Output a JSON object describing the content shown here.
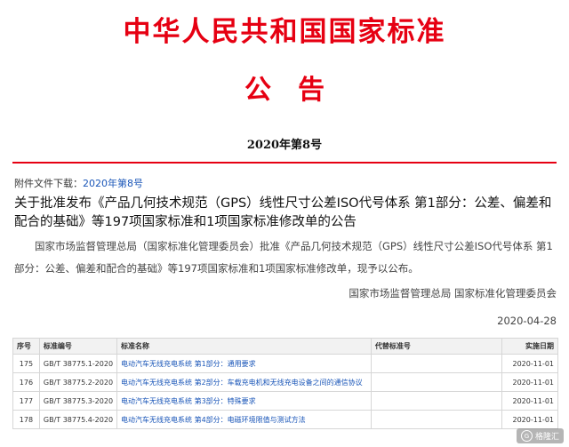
{
  "header": {
    "title": "中华人民共和国国家标准",
    "notice_label": "公告",
    "number": "2020年第8号"
  },
  "attachment": {
    "label": "附件文件下载：",
    "link_text": "2020年第8号"
  },
  "document": {
    "title": "关于批准发布《产品几何技术规范（GPS）线性尺寸公差ISO代号体系 第1部分：公差、偏差和配合的基础》等197项国家标准和1项国家标准修改单的公告",
    "body": "国家市场监督管理总局（国家标准化管理委员会）批准《产品几何技术规范（GPS）线性尺寸公差ISO代号体系 第1部分：公差、偏差和配合的基础》等197项国家标准和1项国家标准修改单，现予以公布。",
    "issuer": "国家市场监督管理总局 国家标准化管理委员会",
    "date": "2020-04-28"
  },
  "table": {
    "headers": {
      "no": "序号",
      "code": "标准编号",
      "name": "标准名称",
      "replaced": "代替标准号",
      "date": "实施日期"
    },
    "rows": [
      {
        "no": "175",
        "code": "GB/T 38775.1-2020",
        "name": "电动汽车无线充电系统 第1部分：通用要求",
        "replaced": "",
        "date": "2020-11-01"
      },
      {
        "no": "176",
        "code": "GB/T 38775.2-2020",
        "name": "电动汽车无线充电系统 第2部分：车载充电机和无线充电设备之间的通信协议",
        "replaced": "",
        "date": "2020-11-01"
      },
      {
        "no": "177",
        "code": "GB/T 38775.3-2020",
        "name": "电动汽车无线充电系统 第3部分：特殊要求",
        "replaced": "",
        "date": "2020-11-01"
      },
      {
        "no": "178",
        "code": "GB/T 38775.4-2020",
        "name": "电动汽车无线充电系统 第4部分：电磁环境限值与测试方法",
        "replaced": "",
        "date": "2020-11-01"
      }
    ]
  },
  "watermark": {
    "icon": "gelonghui-logo-icon",
    "text": "格隆汇"
  },
  "colors": {
    "accent_red": "#e60012",
    "link_blue": "#1a56b8"
  }
}
